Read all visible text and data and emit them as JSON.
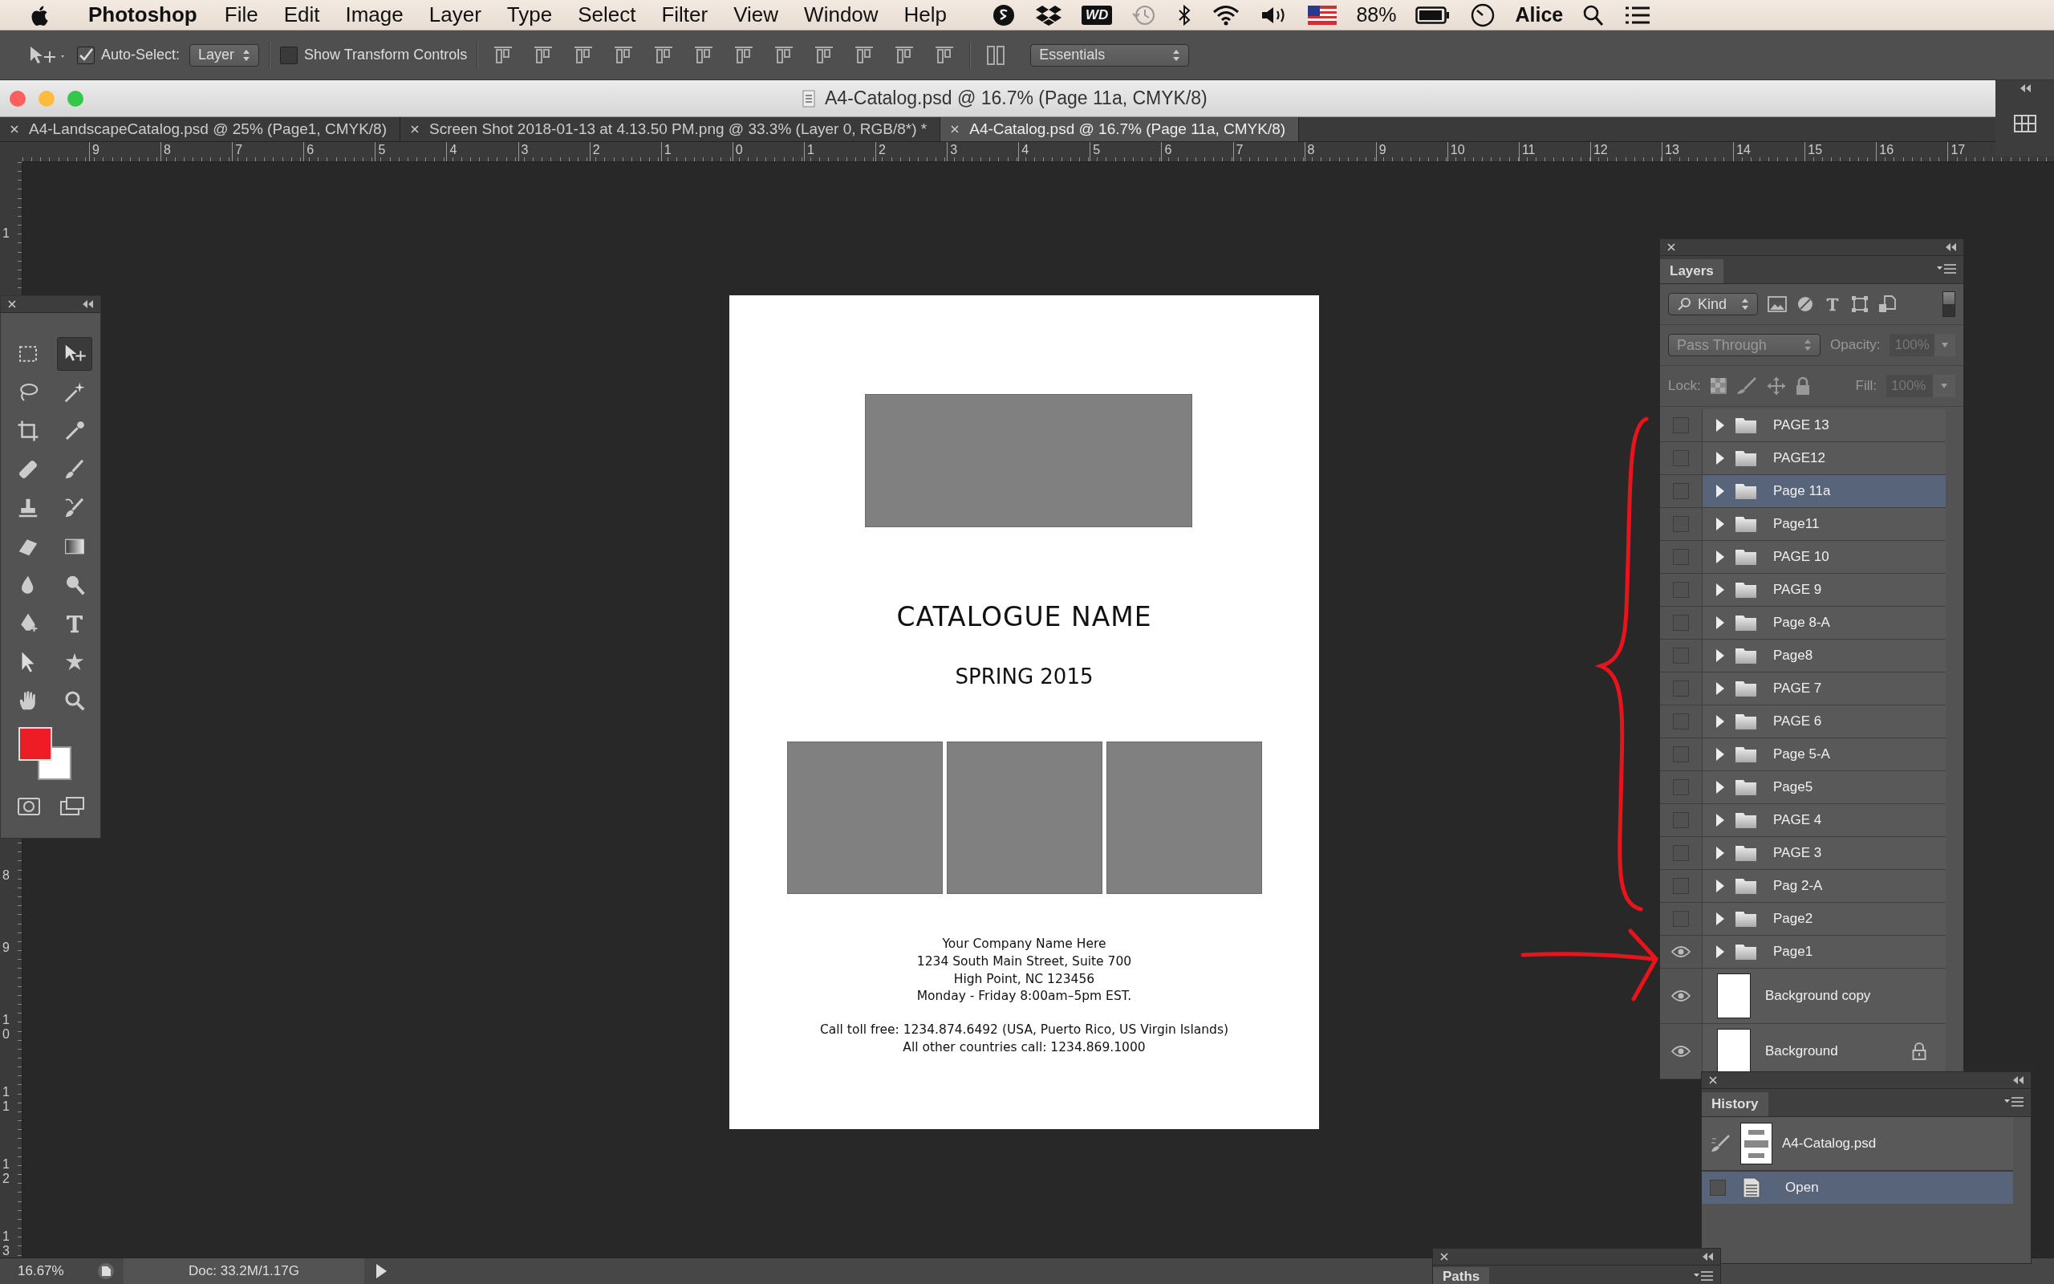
{
  "menu_bar": {
    "app_name": "Photoshop",
    "menus": [
      "File",
      "Edit",
      "Image",
      "Layer",
      "Type",
      "Select",
      "Filter",
      "View",
      "Window",
      "Help"
    ],
    "wd_badge": "WD",
    "battery": "88%",
    "user": "Alice"
  },
  "options_bar": {
    "auto_select": {
      "label": "Auto-Select:",
      "checked": true
    },
    "auto_select_target": "Layer",
    "transform_controls": {
      "label": "Show Transform Controls",
      "checked": false
    },
    "workspace": "Essentials"
  },
  "window": {
    "title": "A4-Catalog.psd @ 16.7% (Page 11a, CMYK/8)"
  },
  "tabs": [
    {
      "label": "A4-LandscapeCatalog.psd @ 25% (Page1, CMYK/8)",
      "selected": false
    },
    {
      "label": "Screen Shot 2018-01-13 at 4.13.50 PM.png @ 33.3% (Layer 0, RGB/8*) *",
      "selected": false
    },
    {
      "label": "A4-Catalog.psd @ 16.7% (Page 11a, CMYK/8)",
      "selected": true
    }
  ],
  "rulers": {
    "horizontal": [
      "9",
      "8",
      "7",
      "6",
      "5",
      "4",
      "3",
      "2",
      "1",
      "0",
      "1",
      "2",
      "3",
      "4",
      "5",
      "6",
      "7",
      "8",
      "9",
      "10",
      "11",
      "12",
      "13",
      "14",
      "15",
      "16",
      "17"
    ],
    "vertical": [
      "1",
      "8",
      "9",
      "10",
      "11",
      "12",
      "13"
    ]
  },
  "tools": {
    "items": [
      {
        "kind": "marquee",
        "selected": false
      },
      {
        "kind": "move",
        "selected": true
      },
      {
        "kind": "lasso",
        "selected": false
      },
      {
        "kind": "wand",
        "selected": false
      },
      {
        "kind": "crop",
        "selected": false
      },
      {
        "kind": "eyedropper",
        "selected": false
      },
      {
        "kind": "healing",
        "selected": false
      },
      {
        "kind": "brush",
        "selected": false
      },
      {
        "kind": "stamp",
        "selected": false
      },
      {
        "kind": "history-brush",
        "selected": false
      },
      {
        "kind": "eraser",
        "selected": false
      },
      {
        "kind": "gradient",
        "selected": false
      },
      {
        "kind": "blur",
        "selected": false
      },
      {
        "kind": "dodge",
        "selected": false
      },
      {
        "kind": "pen",
        "selected": false
      },
      {
        "kind": "type",
        "selected": false
      },
      {
        "kind": "path-select",
        "selected": false
      },
      {
        "kind": "shape",
        "selected": false
      },
      {
        "kind": "hand",
        "selected": false
      },
      {
        "kind": "zoom",
        "selected": false
      }
    ]
  },
  "document": {
    "title": "CATALOGUE NAME",
    "subtitle": "SPRING 2015",
    "address": [
      "Your Company Name Here",
      "1234 South Main Street, Suite 700",
      "High Point, NC 123456",
      "Monday - Friday 8:00am–5pm EST."
    ],
    "contact": [
      "Call toll free: 1234.874.6492 (USA, Puerto Rico, US Virgin Islands)",
      "All other countries call: 1234.869.1000"
    ]
  },
  "layers_panel": {
    "title": "Layers",
    "filter": "Kind",
    "blend_mode": "Pass Through",
    "opacity_label": "Opacity:",
    "opacity": "100%",
    "lock_label": "Lock:",
    "fill_label": "Fill:",
    "fill": "100%",
    "layers": [
      {
        "name": "PAGE 13",
        "kind": "group",
        "visible": false,
        "selected": false,
        "locked": false
      },
      {
        "name": "PAGE12",
        "kind": "group",
        "visible": false,
        "selected": false,
        "locked": false
      },
      {
        "name": "Page 11a",
        "kind": "group",
        "visible": false,
        "selected": true,
        "locked": false
      },
      {
        "name": "Page11",
        "kind": "group",
        "visible": false,
        "selected": false,
        "locked": false
      },
      {
        "name": "PAGE 10",
        "kind": "group",
        "visible": false,
        "selected": false,
        "locked": false
      },
      {
        "name": "PAGE 9",
        "kind": "group",
        "visible": false,
        "selected": false,
        "locked": false
      },
      {
        "name": "Page 8-A",
        "kind": "group",
        "visible": false,
        "selected": false,
        "locked": false
      },
      {
        "name": "Page8",
        "kind": "group",
        "visible": false,
        "selected": false,
        "locked": false
      },
      {
        "name": "PAGE 7",
        "kind": "group",
        "visible": false,
        "selected": false,
        "locked": false
      },
      {
        "name": "PAGE 6",
        "kind": "group",
        "visible": false,
        "selected": false,
        "locked": false
      },
      {
        "name": "Page 5-A",
        "kind": "group",
        "visible": false,
        "selected": false,
        "locked": false
      },
      {
        "name": "Page5",
        "kind": "group",
        "visible": false,
        "selected": false,
        "locked": false
      },
      {
        "name": "PAGE 4",
        "kind": "group",
        "visible": false,
        "selected": false,
        "locked": false
      },
      {
        "name": "PAGE 3",
        "kind": "group",
        "visible": false,
        "selected": false,
        "locked": false
      },
      {
        "name": "Pag 2-A",
        "kind": "group",
        "visible": false,
        "selected": false,
        "locked": false
      },
      {
        "name": "Page2",
        "kind": "group",
        "visible": false,
        "selected": false,
        "locked": false
      },
      {
        "name": "Page1",
        "kind": "group",
        "visible": true,
        "selected": false,
        "locked": false
      },
      {
        "name": "Background copy",
        "kind": "pixel",
        "visible": true,
        "selected": false,
        "locked": false
      },
      {
        "name": "Background",
        "kind": "pixel",
        "visible": true,
        "selected": false,
        "locked": true
      }
    ]
  },
  "history_panel": {
    "title": "History",
    "snapshot": "A4-Catalog.psd",
    "steps": [
      {
        "label": "Open",
        "selected": true
      }
    ]
  },
  "paths_panel": {
    "title": "Paths"
  },
  "status_bar": {
    "zoom": "16.67%",
    "doc_info": "Doc: 33.2M/1.17G"
  }
}
